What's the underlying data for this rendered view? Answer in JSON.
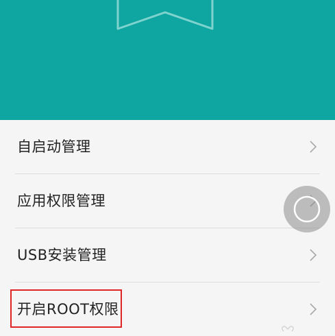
{
  "colors": {
    "header": "#0fa5a0",
    "highlight": "#e02424",
    "list_bg": "#f5f5f5"
  },
  "header": {
    "icon": "bookmark-icon"
  },
  "menu": {
    "items": [
      {
        "label": "自启动管理",
        "icon": "chevron-right-icon"
      },
      {
        "label": "应用权限管理",
        "icon": "chevron-right-icon"
      },
      {
        "label": "USB安装管理",
        "icon": "chevron-right-icon"
      },
      {
        "label": "开启ROOT权限",
        "icon": "chevron-right-icon"
      }
    ]
  },
  "floating_button": {
    "icon": "assistive-touch-icon"
  }
}
